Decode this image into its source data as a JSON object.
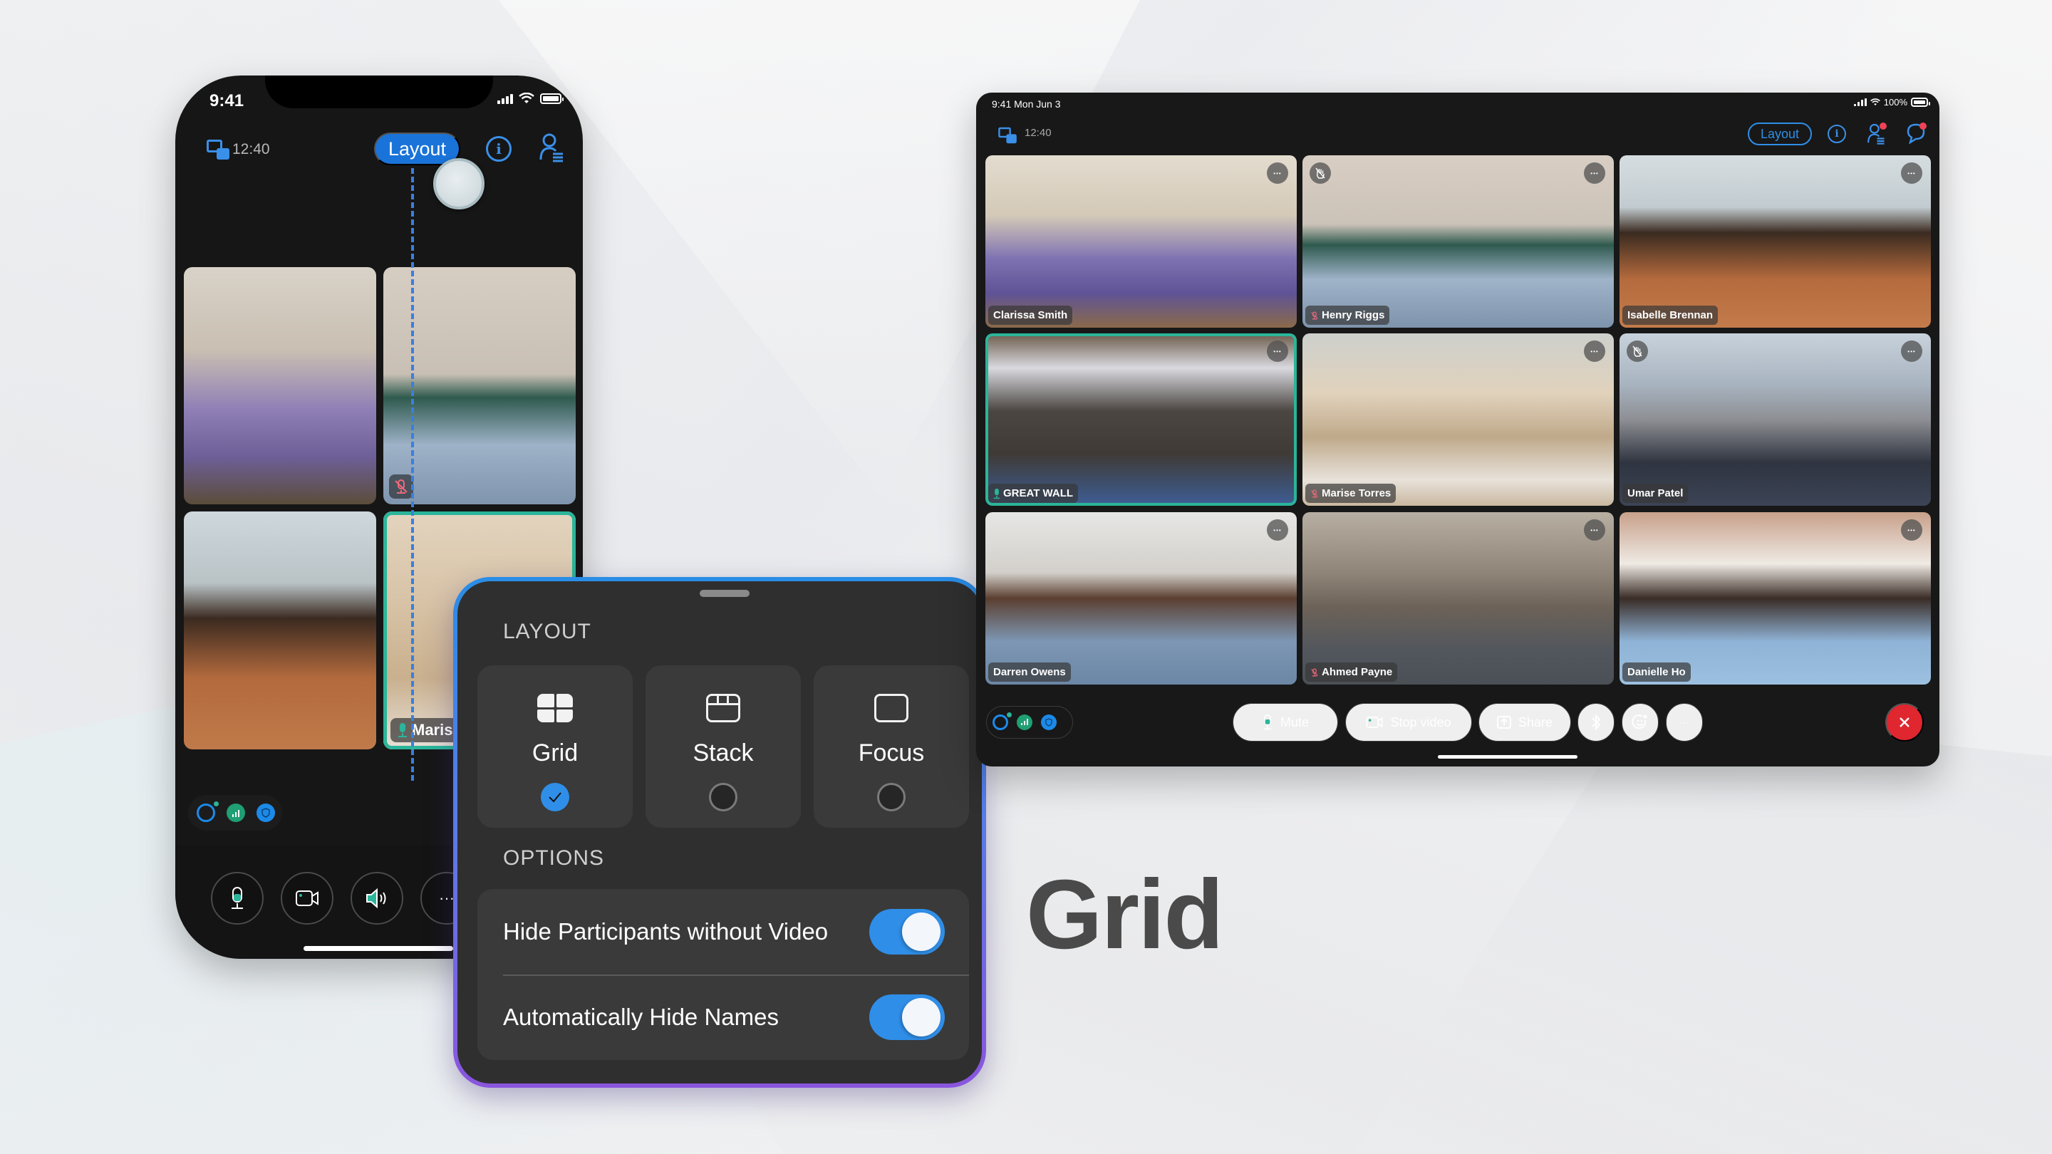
{
  "headline": "Grid",
  "colors": {
    "accent_blue": "#2f8ee8",
    "active_speaker": "#2bb59a",
    "end_call_red": "#e0262f",
    "muted_red": "#f06a7a"
  },
  "phone": {
    "status_time": "9:41",
    "header": {
      "pip_icon": "picture-in-picture-icon",
      "duration": "12:40",
      "layout_button": "Layout",
      "info_icon": "info-icon",
      "participants_icon": "participants-icon"
    },
    "tiles": [
      {
        "name": "",
        "muted": false,
        "active": false
      },
      {
        "name": "",
        "muted": true,
        "active": false
      },
      {
        "name": "",
        "muted": false,
        "active": false
      },
      {
        "name": "Maris",
        "muted": false,
        "active": true
      }
    ],
    "status_icons": [
      "webex-ring-icon",
      "signal-quality-icon",
      "shield-icon"
    ],
    "controls": [
      {
        "icon": "microphone-icon",
        "label": "Mute"
      },
      {
        "icon": "camera-icon",
        "label": "Video"
      },
      {
        "icon": "speaker-icon",
        "label": "Audio"
      },
      {
        "icon": "more-icon",
        "label": "More"
      }
    ]
  },
  "layout_sheet": {
    "layout_heading": "LAYOUT",
    "options": [
      {
        "label": "Grid",
        "icon": "grid-layout-icon",
        "selected": true
      },
      {
        "label": "Stack",
        "icon": "stack-layout-icon",
        "selected": false
      },
      {
        "label": "Focus",
        "icon": "focus-layout-icon",
        "selected": false
      }
    ],
    "options_heading": "OPTIONS",
    "toggles": [
      {
        "label": "Hide Participants without Video",
        "on": true
      },
      {
        "label": "Automatically Hide Names",
        "on": true
      }
    ]
  },
  "tablet": {
    "status_left": "9:41 Mon Jun 3",
    "battery": "100%",
    "header": {
      "duration": "12:40",
      "layout_button": "Layout"
    },
    "tiles": [
      {
        "name": "Clarissa Smith",
        "muted": false,
        "active": false,
        "hand_raised": false
      },
      {
        "name": "Henry Riggs",
        "muted": true,
        "active": false,
        "hand_raised": true
      },
      {
        "name": "Isabelle Brennan",
        "muted": false,
        "active": false,
        "hand_raised": false
      },
      {
        "name": "GREAT WALL",
        "muted": false,
        "active": true,
        "hand_raised": false
      },
      {
        "name": "Marise Torres",
        "muted": true,
        "active": false,
        "hand_raised": false
      },
      {
        "name": "Umar Patel",
        "muted": false,
        "active": false,
        "hand_raised": true
      },
      {
        "name": "Darren Owens",
        "muted": false,
        "active": false,
        "hand_raised": false
      },
      {
        "name": "Ahmed Payne",
        "muted": true,
        "active": false,
        "hand_raised": false
      },
      {
        "name": "Danielle Ho",
        "muted": false,
        "active": false,
        "hand_raised": false
      }
    ],
    "controls": {
      "mute": "Mute",
      "stop_video": "Stop video",
      "share": "Share",
      "bluetooth_icon": "bluetooth-icon",
      "reactions_icon": "reactions-icon",
      "more": "···"
    }
  }
}
